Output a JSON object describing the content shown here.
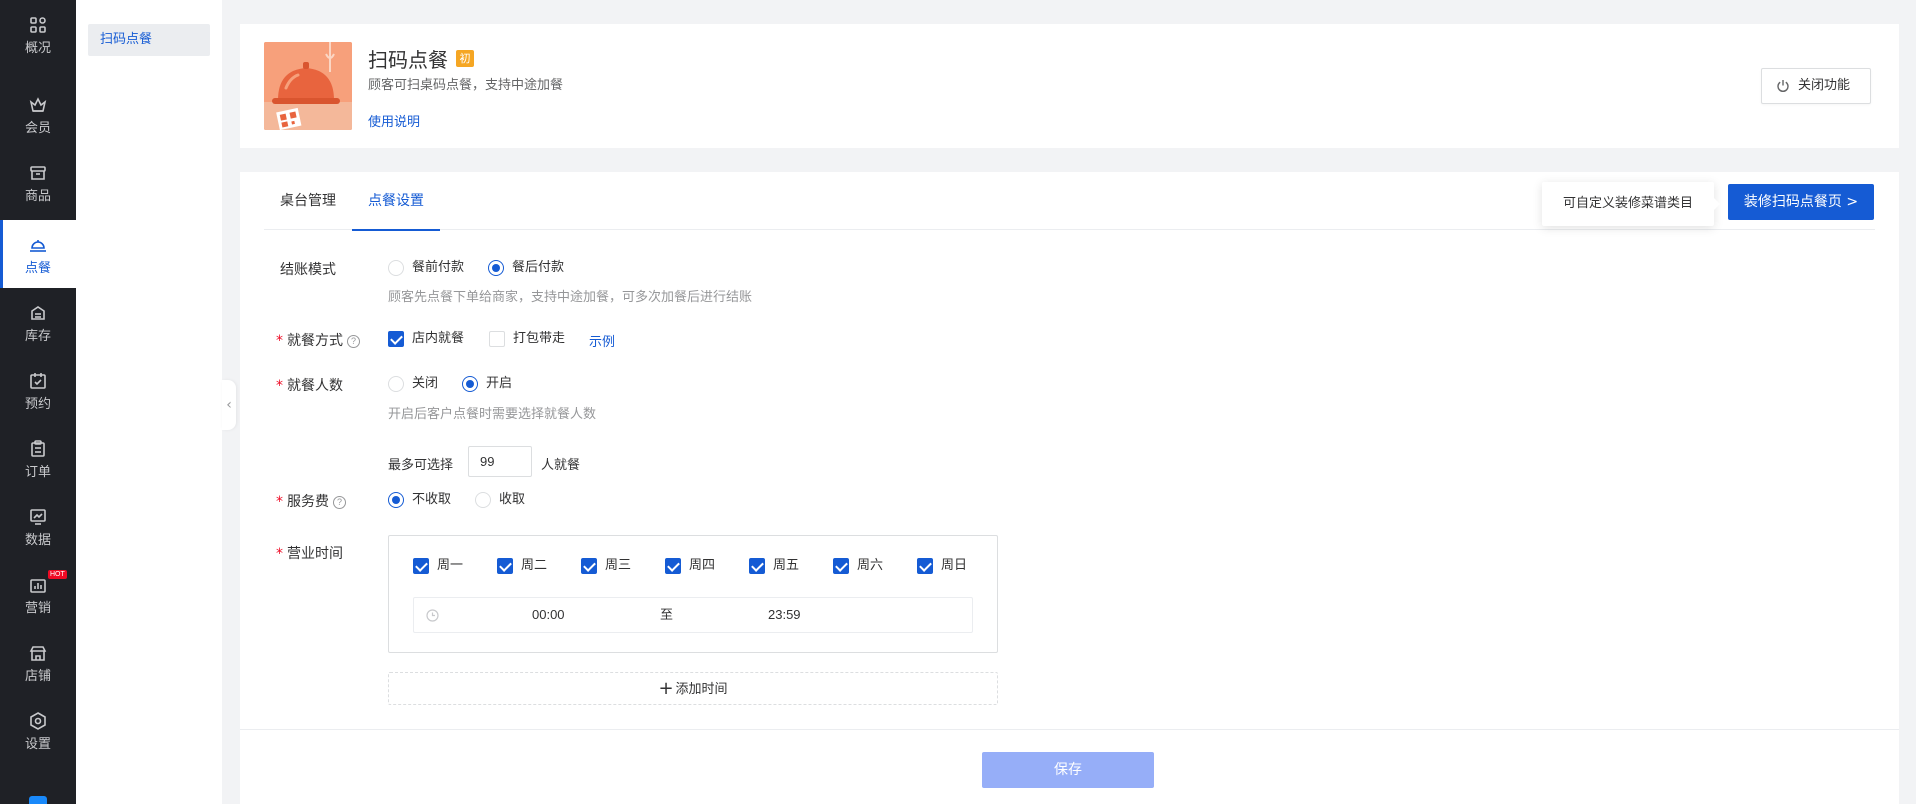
{
  "nav": {
    "items": [
      {
        "label": "概况",
        "icon": "overview-icon"
      },
      {
        "label": "会员",
        "icon": "crown-icon"
      },
      {
        "label": "商品",
        "icon": "goods-icon"
      },
      {
        "label": "点餐",
        "icon": "dining-bell-icon"
      },
      {
        "label": "库存",
        "icon": "inventory-icon"
      },
      {
        "label": "预约",
        "icon": "calendar-check-icon"
      },
      {
        "label": "订单",
        "icon": "order-icon"
      },
      {
        "label": "数据",
        "icon": "data-icon"
      },
      {
        "label": "营销",
        "icon": "marketing-icon"
      },
      {
        "label": "店铺",
        "icon": "store-icon"
      },
      {
        "label": "设置",
        "icon": "settings-icon"
      }
    ],
    "active_index": 3,
    "hot_badge": "HOT"
  },
  "subnav": {
    "item": "扫码点餐"
  },
  "feature": {
    "title": "扫码点餐",
    "badge": "初",
    "subtitle": "顾客可扫桌码点餐，支持中途加餐",
    "help_link": "使用说明",
    "close_button": "关闭功能"
  },
  "tabs": [
    {
      "label": "桌台管理",
      "active": false
    },
    {
      "label": "点餐设置",
      "active": true
    }
  ],
  "tip": "可自定义装修菜谱类目",
  "decorate_button": "装修扫码点餐页 >",
  "form": {
    "checkout": {
      "label": "结账模式",
      "options": [
        "餐前付款",
        "餐后付款"
      ],
      "selected": 1,
      "hint": "顾客先点餐下单给商家，支持中途加餐，可多次加餐后进行结账"
    },
    "dining_mode": {
      "label": "就餐方式",
      "options": [
        {
          "label": "店内就餐",
          "checked": true
        },
        {
          "label": "打包带走",
          "checked": false
        }
      ],
      "example_link": "示例"
    },
    "guest_count": {
      "label": "就餐人数",
      "options": [
        "关闭",
        "开启"
      ],
      "selected": 1,
      "hint": "开启后客户点餐时需要选择就餐人数",
      "max_prefix": "最多可选择",
      "max_value": "99",
      "max_suffix": "人就餐"
    },
    "service_fee": {
      "label": "服务费",
      "options": [
        "不收取",
        "收取"
      ],
      "selected": 0
    },
    "hours": {
      "label": "营业时间",
      "days": [
        {
          "label": "周一",
          "checked": true
        },
        {
          "label": "周二",
          "checked": true
        },
        {
          "label": "周三",
          "checked": true
        },
        {
          "label": "周四",
          "checked": true
        },
        {
          "label": "周五",
          "checked": true
        },
        {
          "label": "周六",
          "checked": true
        },
        {
          "label": "周日",
          "checked": true
        }
      ],
      "start": "00:00",
      "separator": "至",
      "end": "23:59",
      "add_time": "添加时间"
    }
  },
  "save_button": "保存",
  "colors": {
    "primary": "#155bd4",
    "nav_bg": "#1f2126",
    "required": "#ee0a24",
    "save_disabled": "#96aef8"
  }
}
